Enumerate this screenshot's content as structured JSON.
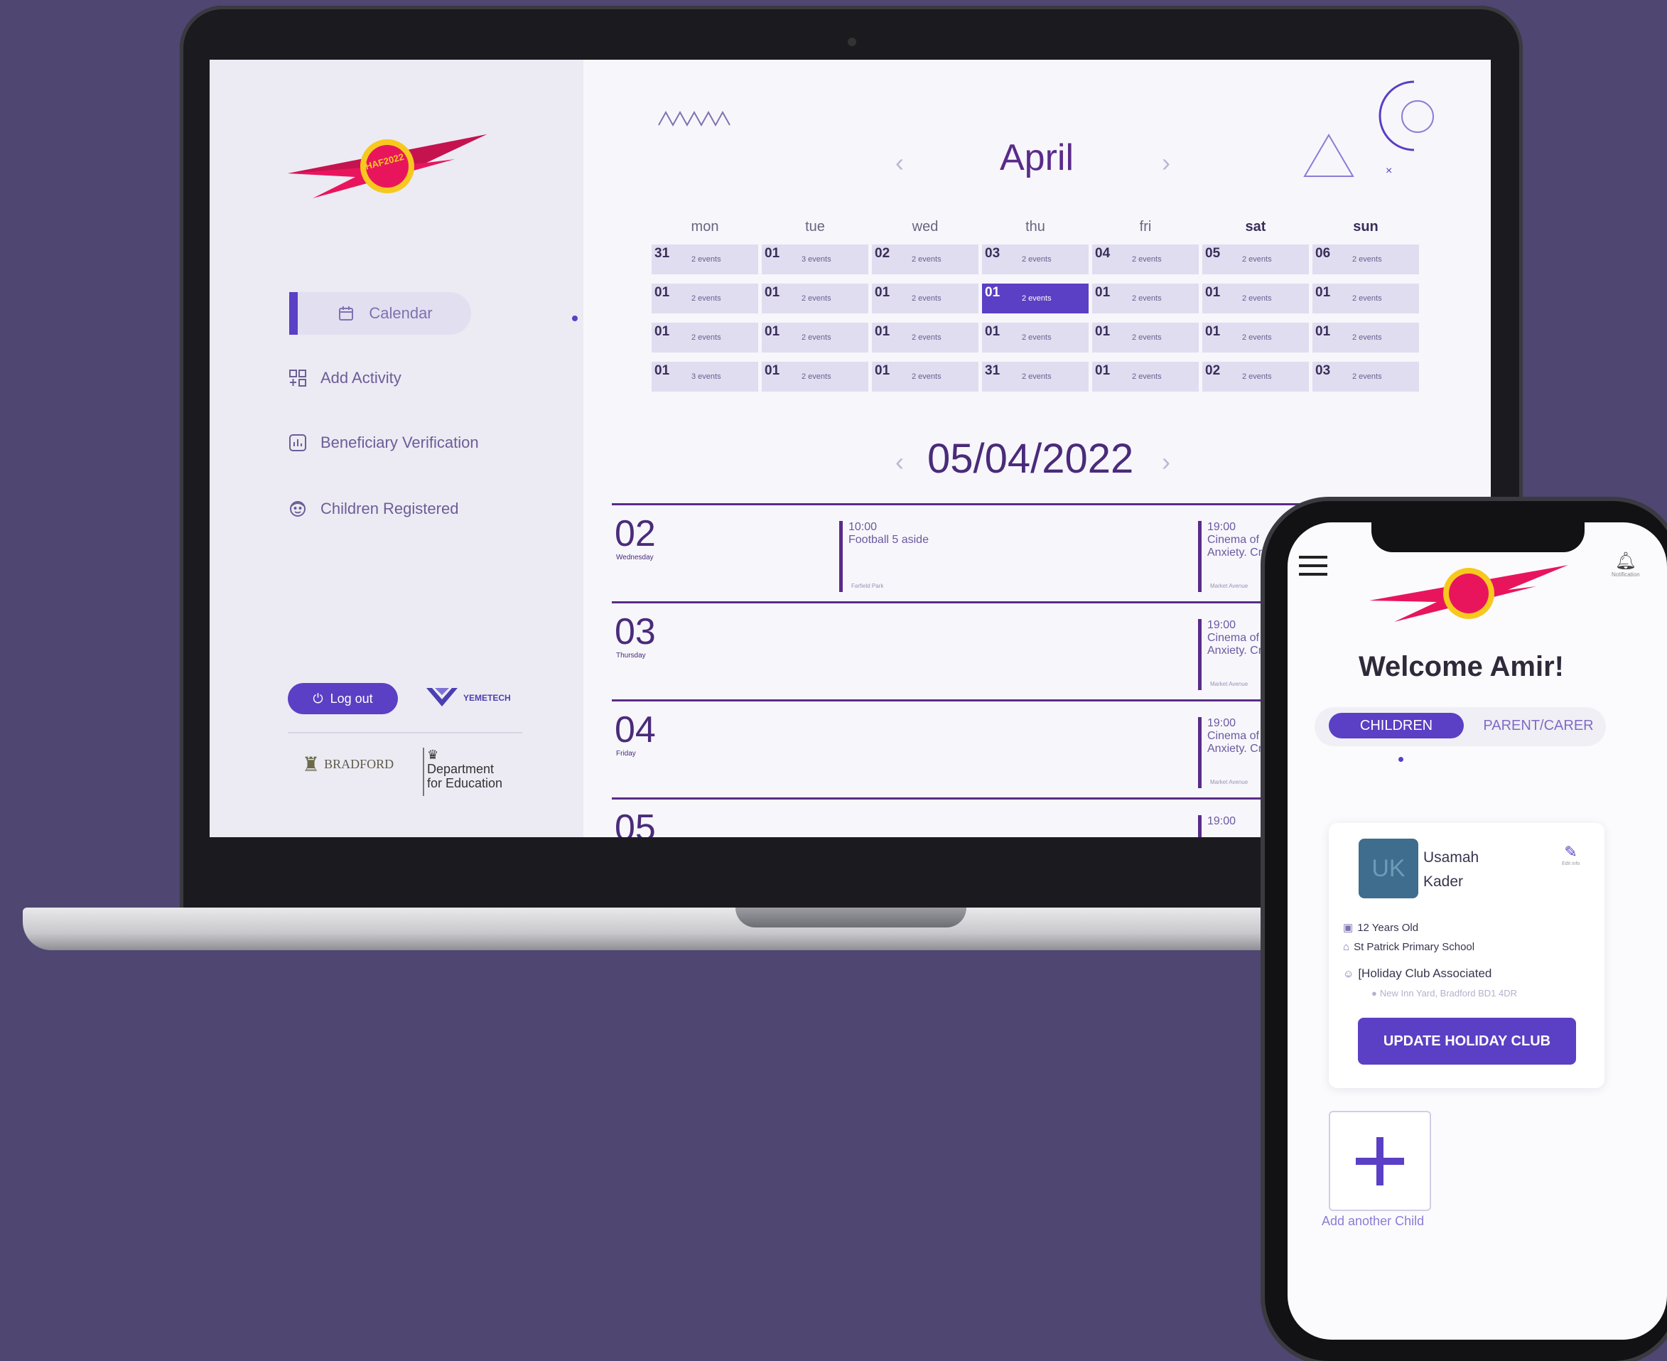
{
  "app": {
    "brand_logo": "#HAF2022 Summer of Fun"
  },
  "sidebar": {
    "nav": [
      {
        "label": "Calendar",
        "icon": "calendar-icon"
      },
      {
        "label": "Add Activity",
        "icon": "add-activity-icon"
      },
      {
        "label": "Beneficiary Verification",
        "icon": "chart-icon"
      },
      {
        "label": "Children Registered",
        "icon": "child-icon"
      }
    ],
    "logout_label": "Log out",
    "yemetech_label": "YEMETECH",
    "bradford_label": "BRADFORD",
    "dfe_line1": "Department",
    "dfe_line2": "for Education"
  },
  "calendar": {
    "month": "April",
    "prev_arrow": "‹",
    "next_arrow": "›",
    "weekdays": [
      "mon",
      "tue",
      "wed",
      "thu",
      "fri",
      "sat",
      "sun"
    ],
    "rows": [
      [
        {
          "d": "31",
          "e": "2 events"
        },
        {
          "d": "01",
          "e": "3 events"
        },
        {
          "d": "02",
          "e": "2 events"
        },
        {
          "d": "03",
          "e": "2 events"
        },
        {
          "d": "04",
          "e": "2 events"
        },
        {
          "d": "05",
          "e": "2 events"
        },
        {
          "d": "06",
          "e": "2 events"
        }
      ],
      [
        {
          "d": "01",
          "e": "2 events"
        },
        {
          "d": "01",
          "e": "2 events"
        },
        {
          "d": "01",
          "e": "2 events"
        },
        {
          "d": "01",
          "e": "2 events"
        },
        {
          "d": "01",
          "e": "2 events"
        },
        {
          "d": "01",
          "e": "2 events"
        },
        {
          "d": "01",
          "e": "2 events"
        }
      ],
      [
        {
          "d": "01",
          "e": "2 events"
        },
        {
          "d": "01",
          "e": "2 events"
        },
        {
          "d": "01",
          "e": "2 events"
        },
        {
          "d": "01",
          "e": "2 events"
        },
        {
          "d": "01",
          "e": "2 events"
        },
        {
          "d": "01",
          "e": "2 events"
        },
        {
          "d": "01",
          "e": "2 events"
        }
      ],
      [
        {
          "d": "01",
          "e": "3 events"
        },
        {
          "d": "01",
          "e": "2 events"
        },
        {
          "d": "01",
          "e": "2 events"
        },
        {
          "d": "31",
          "e": "2 events"
        },
        {
          "d": "01",
          "e": "2 events"
        },
        {
          "d": "02",
          "e": "2 events"
        },
        {
          "d": "03",
          "e": "2 events"
        }
      ]
    ],
    "selected_cell": {
      "row": 1,
      "col": 3
    }
  },
  "schedule": {
    "date": "05/04/2022",
    "days": [
      {
        "num": "02",
        "weekday": "Wednesday"
      },
      {
        "num": "03",
        "weekday": "Thursday"
      },
      {
        "num": "04",
        "weekday": "Friday"
      },
      {
        "num": "05",
        "weekday": ""
      }
    ],
    "football": {
      "time": "10:00",
      "name": "Football 5 aside",
      "loc": "Farfield Park"
    },
    "cinema": {
      "time": "19:00",
      "name": "Cinema of Anxiety. Cr",
      "loc": "Market Avenue"
    }
  },
  "phone": {
    "notification_label": "Notification",
    "welcome": "Welcome Amir!",
    "tab_children": "CHILDREN",
    "tab_parent": "PARENT/CARER",
    "child": {
      "initials": "UK",
      "first_name": "Usamah",
      "last_name": "Kader",
      "edit_label": "Edit info",
      "age": "12 Years Old",
      "school": "St Patrick Primary School",
      "club": "[Holiday Club Associated",
      "club_address": "New Inn Yard, Bradford BD1 4DR"
    },
    "update_button": "UPDATE HOLIDAY CLUB",
    "add_child_label": "Add another Child"
  },
  "colors": {
    "background": "#4f4672",
    "accent": "#5b3fc4",
    "heading": "#5a2b8a"
  }
}
